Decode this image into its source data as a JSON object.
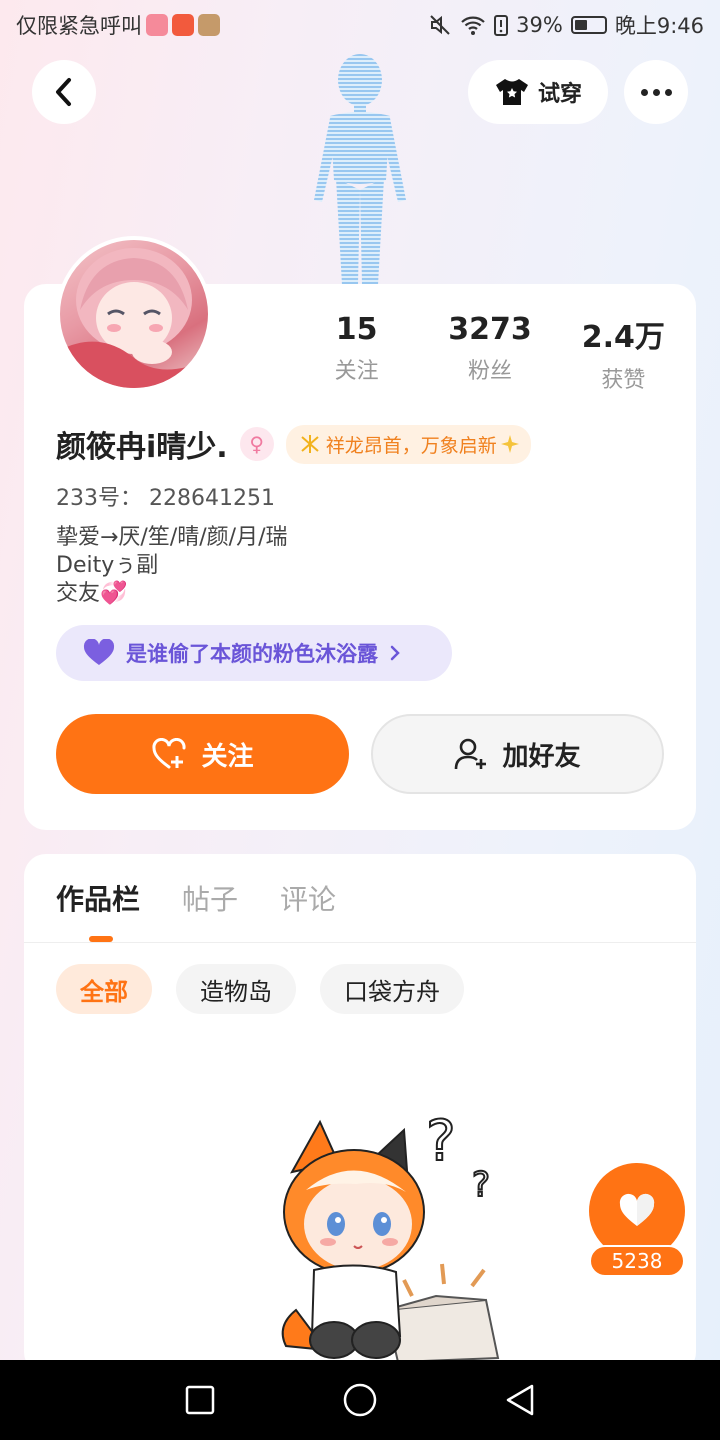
{
  "status_bar": {
    "left_text": "仅限紧急呼叫",
    "battery": "39%",
    "time": "晚上9:46"
  },
  "header": {
    "try_on_label": "试穿"
  },
  "profile": {
    "stats": [
      {
        "value": "15",
        "label": "关注"
      },
      {
        "value": "3273",
        "label": "粉丝"
      },
      {
        "value": "2.4万",
        "label": "获赞"
      }
    ],
    "name": "颜筱冉i晴少.",
    "gender_symbol": "♀",
    "badge_text": "祥龙昂首，万象启新",
    "uid": "233号： 228641251",
    "bio_lines": [
      "挚爱→厌/笙/晴/颜/月/瑞",
      "Deityぅ副",
      "交友💞"
    ],
    "tag_pill": "是谁偷了本颜的粉色沐浴露",
    "follow_label": "关注",
    "add_friend_label": "加好友"
  },
  "works": {
    "tabs": [
      "作品栏",
      "帖子",
      "评论"
    ],
    "chips": [
      "全部",
      "造物岛",
      "口袋方舟"
    ]
  },
  "like_count": "5238",
  "colors": {
    "accent": "#ff7314",
    "tag_purple": "#6a55d8"
  }
}
